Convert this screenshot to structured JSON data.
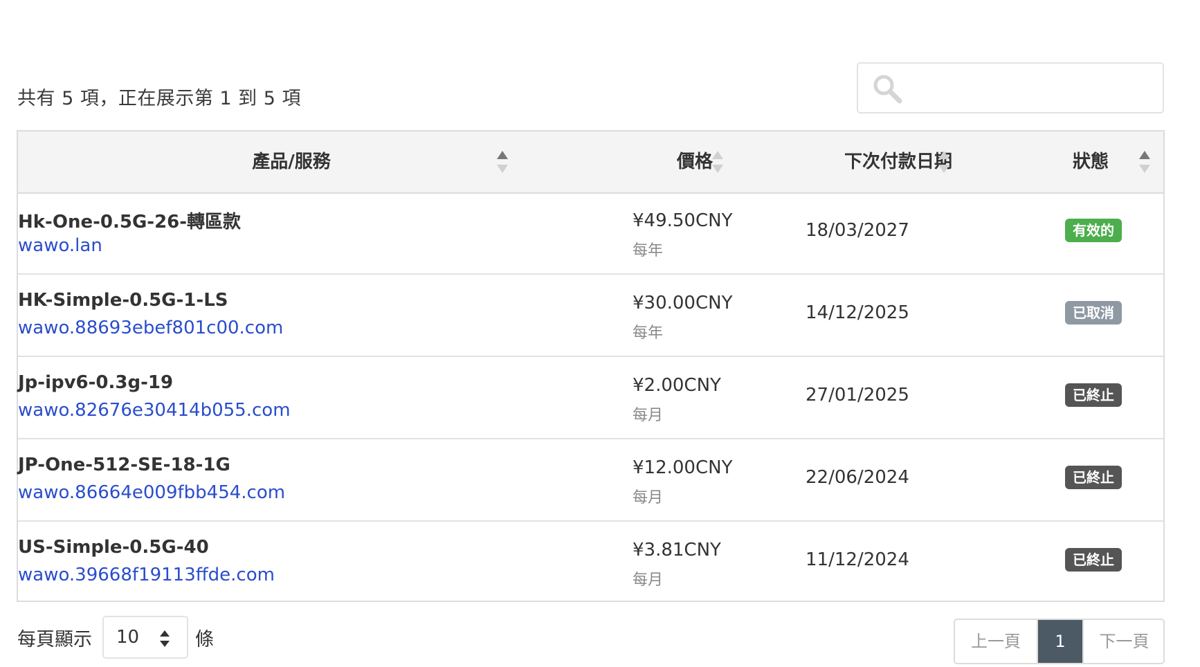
{
  "summary_text": "共有 5 項，正在展示第 1 到 5 項",
  "search": {
    "placeholder": "",
    "value": ""
  },
  "table": {
    "headers": [
      "產品/服務",
      "價格",
      "下次付款日期",
      "狀態"
    ],
    "rows": [
      {
        "product": "Hk-One-0.5G-26-轉區款",
        "domain": "wawo.lan",
        "price": "¥49.50CNY",
        "cycle": "每年",
        "next_due": "18/03/2027",
        "status": "有效的",
        "status_color": "#4cae4c"
      },
      {
        "product": "HK-Simple-0.5G-1-LS",
        "domain": "wawo.88693ebef801c00.com",
        "price": "¥30.00CNY",
        "cycle": "每年",
        "next_due": "14/12/2025",
        "status": "已取消",
        "status_color": "#8e99a3"
      },
      {
        "product": "Jp-ipv6-0.3g-19",
        "domain": "wawo.82676e30414b055.com",
        "price": "¥2.00CNY",
        "cycle": "每月",
        "next_due": "27/01/2025",
        "status": "已終止",
        "status_color": "#555555"
      },
      {
        "product": "JP-One-512-SE-18-1G",
        "domain": "wawo.86664e009fbb454.com",
        "price": "¥12.00CNY",
        "cycle": "每月",
        "next_due": "22/06/2024",
        "status": "已終止",
        "status_color": "#555555"
      },
      {
        "product": "US-Simple-0.5G-40",
        "domain": "wawo.39668f19113ffde.com",
        "price": "¥3.81CNY",
        "cycle": "每月",
        "next_due": "11/12/2024",
        "status": "已終止",
        "status_color": "#555555"
      }
    ]
  },
  "footer": {
    "per_page_label": "每頁顯示",
    "per_page_value": "10",
    "per_page_suffix": "條",
    "prev_label": "上一頁",
    "current_page": "1",
    "next_label": "下一頁"
  },
  "colors": {
    "link": "#2a4dcc",
    "active_page": "#4c5a66",
    "header_bg": "#f4f4f4"
  },
  "icons": {
    "search": "search-icon",
    "sort": "sort-arrows-icon",
    "select_caret": "updown-caret-icon"
  }
}
